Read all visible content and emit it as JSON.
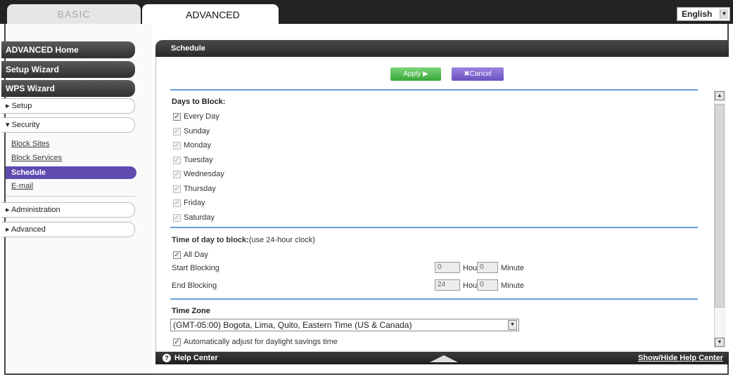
{
  "tabs": {
    "basic": "BASIC",
    "advanced": "ADVANCED"
  },
  "language": {
    "selected": "English"
  },
  "sidebar": {
    "advanced_home": "ADVANCED Home",
    "setup_wizard": "Setup Wizard",
    "wps_wizard": "WPS Wizard",
    "setup": "▸ Setup",
    "security": "▾ Security",
    "links": [
      "Block Sites",
      "Block Services",
      "Schedule",
      "E-mail"
    ],
    "administration": "▸ Administration",
    "advanced": "▸ Advanced"
  },
  "panel": {
    "title": "Schedule"
  },
  "buttons": {
    "apply": "Apply ▶",
    "cancel": "✖Cancel"
  },
  "days": {
    "heading": "Days to Block:",
    "every_day": "Every Day",
    "list": [
      "Sunday",
      "Monday",
      "Tuesday",
      "Wednesday",
      "Thursday",
      "Friday",
      "Saturday"
    ]
  },
  "time": {
    "heading_bold": "Time of day to block:",
    "heading_rest": "(use 24-hour clock)",
    "all_day": "All Day",
    "start_label": "Start Blocking",
    "end_label": "End Blocking",
    "start_hour": "0",
    "start_minute": "0",
    "end_hour": "24",
    "end_minute": "0",
    "hour_label": "Hour",
    "minute_label": "Minute"
  },
  "timezone": {
    "heading": "Time Zone",
    "selected": "(GMT-05:00) Bogota, Lima, Quito, Eastern Time (US & Canada)",
    "dst_label": "Automatically adjust for daylight savings time"
  },
  "footer": {
    "help_center": "Help Center",
    "show_hide": "Show/Hide Help Center"
  },
  "colors": {
    "accent_purple": "#5f4bb0",
    "apply_green": "#38a838",
    "rule_blue": "#6a9ed8"
  }
}
